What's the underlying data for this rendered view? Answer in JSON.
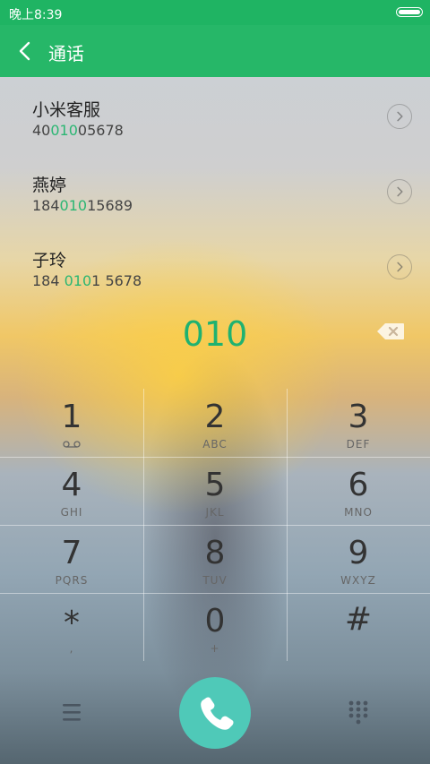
{
  "status": {
    "time": "晚上8:39"
  },
  "header": {
    "title": "通话"
  },
  "contacts": [
    {
      "name": "小米客服",
      "num_prefix": "40",
      "num_match": "010",
      "num_suffix": "05678"
    },
    {
      "name": "燕婷",
      "num_prefix": "184",
      "num_match": "010",
      "num_suffix": "15689"
    },
    {
      "name": "子玲",
      "num_prefix": "184 ",
      "num_match": "010",
      "num_suffix": "1 5678"
    }
  ],
  "dial": {
    "input": "010"
  },
  "keys": [
    {
      "digit": "1",
      "letters": ""
    },
    {
      "digit": "2",
      "letters": "ABC"
    },
    {
      "digit": "3",
      "letters": "DEF"
    },
    {
      "digit": "4",
      "letters": "GHI"
    },
    {
      "digit": "5",
      "letters": "JKL"
    },
    {
      "digit": "6",
      "letters": "MNO"
    },
    {
      "digit": "7",
      "letters": "PQRS"
    },
    {
      "digit": "8",
      "letters": "TUV"
    },
    {
      "digit": "9",
      "letters": "WXYZ"
    },
    {
      "digit": "*",
      "letters": ","
    },
    {
      "digit": "0",
      "letters": "+"
    },
    {
      "digit": "#",
      "letters": ""
    }
  ],
  "icons": {
    "voicemail": "voicemail-icon",
    "menu": "menu-icon",
    "call": "phone-icon",
    "dialpad": "dialpad-icon"
  },
  "colors": {
    "accent": "#26b768",
    "match": "#2bb673",
    "call_button": "#4fc9b8"
  }
}
